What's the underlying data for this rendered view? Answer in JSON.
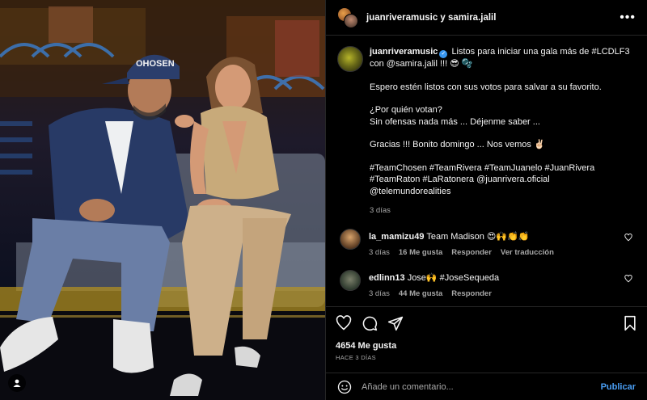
{
  "header": {
    "title": "juanriveramusic y samira.jalil",
    "more_icon": "more-horizontal-icon"
  },
  "post": {
    "username": "juanriveramusic",
    "verified": true,
    "lines": [
      "Listos para iniciar una gala más de #LCDLF3 con @samira.jalil !!! 😎 🫧",
      "Espero estén listos con sus votos para salvar a su favorito.",
      "¿Por quién votan?",
      "Sin ofensas nada más ... Déjenme saber ...",
      "Gracias !!! Bonito domingo ... Nos vemos ✌🏻",
      "#TeamChosen #TeamRivera #TeamJuanelo #JuanRivera",
      "#TeamRaton #LaRatonera @juanrivera.oficial",
      "@telemundorealities"
    ],
    "time": "3 días"
  },
  "comments": [
    {
      "username": "la_mamizu49",
      "text": "Team Madison 😍🙌👏👏",
      "time": "3 días",
      "likes": "16 Me gusta",
      "reply": "Responder",
      "translate": "Ver traducción"
    },
    {
      "username": "edlinn13",
      "text": "Jose🙌 #JoseSequeda",
      "time": "3 días",
      "likes": "44 Me gusta",
      "reply": "Responder"
    }
  ],
  "actions": {
    "icons": [
      "heart-icon",
      "comment-icon",
      "share-icon",
      "bookmark-icon"
    ],
    "likes": "4654 Me gusta",
    "ago": "HACE 3 DÍAS"
  },
  "composer": {
    "placeholder": "Añade un comentario...",
    "publish": "Publicar"
  },
  "photo": {
    "cap_text": "OHOSEN"
  }
}
